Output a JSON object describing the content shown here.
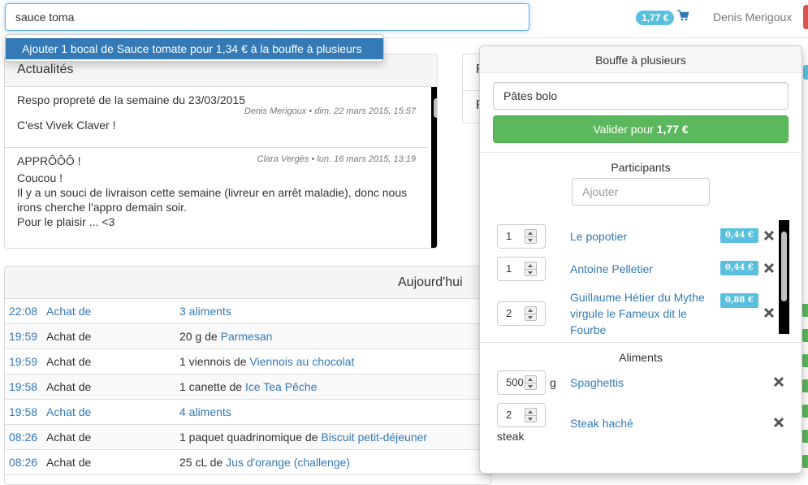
{
  "header": {
    "search_value": "sauce toma",
    "suggestion": "Ajouter 1 bocal de Sauce tomate pour 1,34 € à la bouffe à plusieurs",
    "cart_total": "1,77 €",
    "cart_icon": "shopping-cart-icon",
    "user": "Denis Merigoux"
  },
  "news": {
    "title": "Actualités",
    "items": [
      {
        "title": "Respo propreté de la semaine du 23/03/2015",
        "meta": "Denis Merigoux • dim. 22 mars 2015, 15:57",
        "body": "C'est Vivek Claver !"
      },
      {
        "title": "APPRÔÔÔ !",
        "meta": "Clara Vergès • lun. 16 mars 2015, 13:19",
        "body": "Coucou !\nIl y a un souci de livraison cette semaine (livreur en arrêt maladie), donc nous irons cherche l'appro demain soir.\nPour le plaisir ... <3"
      }
    ]
  },
  "mid_panel": {
    "row1_letter": "F",
    "row2_letter": "F"
  },
  "today": {
    "title": "Aujourd'hui",
    "rows": [
      {
        "time": "22:08",
        "action": "Achat de",
        "qty": "",
        "item": "3 aliments",
        "time_link": true,
        "action_link": true
      },
      {
        "time": "19:59",
        "action": "Achat de",
        "qty": "20 g de ",
        "item": "Parmesan",
        "time_link": true,
        "action_link": false
      },
      {
        "time": "19:59",
        "action": "Achat de",
        "qty": "1 viennois de ",
        "item": "Viennois au chocolat",
        "time_link": true,
        "action_link": false
      },
      {
        "time": "19:58",
        "action": "Achat de",
        "qty": "1 canette de ",
        "item": "Ice Tea Pêche",
        "time_link": true,
        "action_link": false
      },
      {
        "time": "19:58",
        "action": "Achat de",
        "qty": "",
        "item": "4 aliments",
        "time_link": true,
        "action_link": true
      },
      {
        "time": "08:26",
        "action": "Achat de",
        "qty": "1 paquet quadrinomique de ",
        "item": "Biscuit petit-déjeuner",
        "time_link": true,
        "action_link": false
      },
      {
        "time": "08:26",
        "action": "Achat de",
        "qty": "25 cL de ",
        "item": "Jus d'orange (challenge)",
        "time_link": true,
        "action_link": false
      }
    ]
  },
  "popover": {
    "title": "Bouffe à plusieurs",
    "order_name": "Pâtes bolo",
    "validate_label": "Valider pour ",
    "validate_amount": "1,77 €",
    "participants_title": "Participants",
    "add_placeholder": "Ajouter",
    "participants": [
      {
        "qty": "1",
        "name": "Le popotier",
        "amount": "0,44 €"
      },
      {
        "qty": "1",
        "name": "Antoine Pelletier",
        "amount": "0,44 €"
      },
      {
        "qty": "2",
        "name": "Guillaume Hétier du Mythe virgule le Fameux dit le Fourbe",
        "amount": "0,88 €"
      }
    ],
    "foods_title": "Aliments",
    "foods": [
      {
        "qty": "500",
        "unit": "g",
        "name": "Spaghettis"
      },
      {
        "qty": "2",
        "unit": "steak",
        "name": "Steak haché"
      }
    ],
    "remove_icon": "close-icon",
    "stepper_icon": "spinner-arrows-icon"
  },
  "colors": {
    "primary": "#337ab7",
    "success": "#5cb85c",
    "info": "#5bc0de",
    "danger": "#d9534f"
  }
}
